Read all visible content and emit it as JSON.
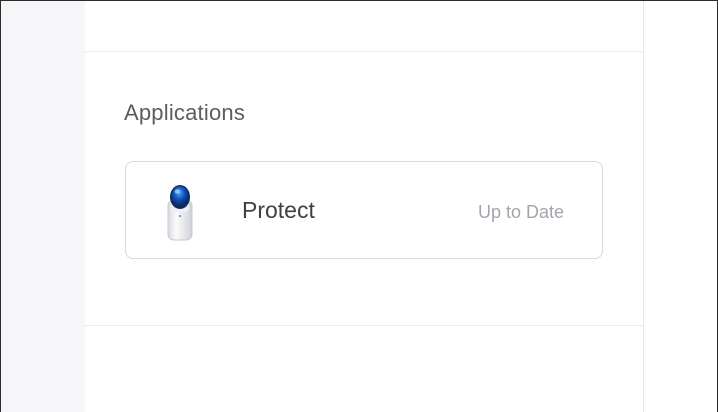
{
  "applications": {
    "title": "Applications",
    "items": [
      {
        "name": "Protect",
        "status": "Up to Date",
        "icon": "camera-icon"
      }
    ]
  },
  "colors": {
    "sidebar": "#f6f6f8",
    "status_text": "#a3a5ab",
    "title_text": "#5b5d63"
  }
}
